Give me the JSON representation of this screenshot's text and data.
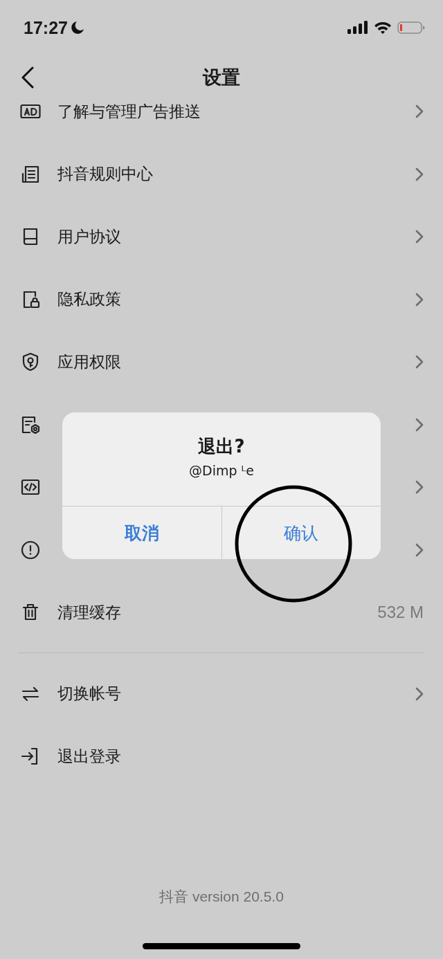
{
  "status_bar": {
    "time": "17:27"
  },
  "nav": {
    "title": "设置"
  },
  "settings": [
    {
      "kind": "ad",
      "label": "了解与管理广告推送",
      "arrow": true
    },
    {
      "kind": "rules",
      "label": "抖音规则中心",
      "arrow": true
    },
    {
      "kind": "book",
      "label": "用户协议",
      "arrow": true
    },
    {
      "kind": "lock",
      "label": "隐私政策",
      "arrow": true
    },
    {
      "kind": "shield",
      "label": "应用权限",
      "arrow": true
    },
    {
      "kind": "data",
      "arrow": true
    },
    {
      "kind": "code",
      "arrow": true
    },
    {
      "kind": "info",
      "arrow": true
    },
    {
      "kind": "trash",
      "label": "清理缓存",
      "value": "532 M",
      "arrow": false
    }
  ],
  "account": [
    {
      "kind": "switch",
      "label": "切换帐号",
      "arrow": true
    },
    {
      "kind": "logout",
      "label": "退出登录",
      "arrow": false
    }
  ],
  "footer": "抖音 version 20.5.0",
  "dialog": {
    "title": "退出?",
    "message": "@Dimp ᴸe",
    "buttons": [
      {
        "label": "取消",
        "kind": "cancel"
      },
      {
        "label": "确认",
        "kind": "confirm"
      }
    ]
  }
}
